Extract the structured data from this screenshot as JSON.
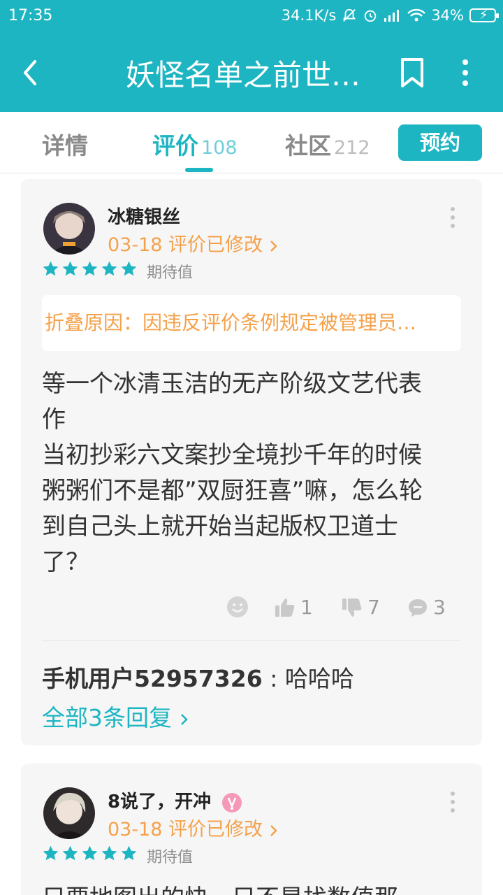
{
  "status_bar": {
    "time": "17:35",
    "net_speed": "34.1K/s",
    "battery": "34%"
  },
  "header": {
    "title": "妖怪名单之前世…",
    "back_icon": "chevron-left-icon",
    "bookmark_icon": "bookmark-icon",
    "more_icon": "more-vertical-icon"
  },
  "tabs": {
    "details": "详情",
    "reviews": "评价",
    "reviews_count": "108",
    "community": "社区",
    "community_count": "212",
    "reserve_button": "预约"
  },
  "reviews": [
    {
      "username": "冰糖银丝",
      "date": "03-18 评价已修改",
      "rating": 5,
      "rating_label": "期待值",
      "fold_reason": "折叠原因：因违反评价条例规定被管理员…",
      "text": "等一个冰清玉洁的无产阶级文艺代表\n作\n当初抄彩六文案抄全境抄千年的时候\n粥粥们不是都”双厨狂喜”嘛，怎么轮\n到自己头上就开始当起版权卫道士\n了？",
      "likes": "1",
      "dislikes": "7",
      "comments": "3",
      "reply_user": "手机用户52957326",
      "reply_sep": " : ",
      "reply_text": "哈哈哈",
      "all_replies": "全部3条回复"
    },
    {
      "username": "8说了，开冲",
      "date": "03-18 评价已修改",
      "rating": 5,
      "rating_label": "期待值",
      "text": "只要地图出的快，只不是找数值那"
    }
  ],
  "colors": {
    "accent": "#1eb5c2",
    "orange": "#f5a14a",
    "card_bg": "#f6f6f6"
  }
}
